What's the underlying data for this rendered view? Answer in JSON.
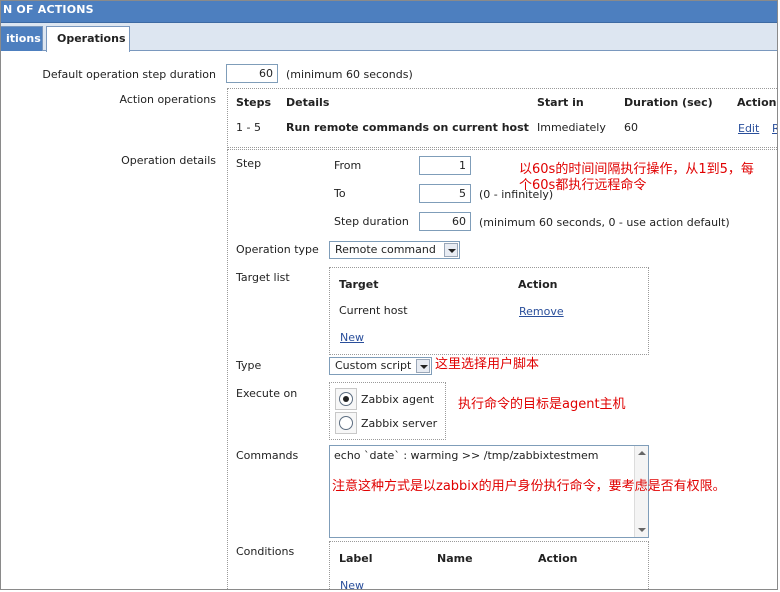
{
  "window": {
    "title": "N OF ACTIONS"
  },
  "tabs": [
    {
      "label": "itions",
      "active": false
    },
    {
      "label": "Operations",
      "active": true
    }
  ],
  "default_step": {
    "label": "Default operation step duration",
    "value": "60",
    "hint": "(minimum 60 seconds)"
  },
  "action_operations": {
    "label": "Action operations",
    "headers": {
      "steps": "Steps",
      "details": "Details",
      "start_in": "Start in",
      "duration": "Duration (sec)",
      "action": "Action"
    },
    "rows": [
      {
        "steps": "1 - 5",
        "details": "Run remote commands on current host",
        "start_in": "Immediately",
        "duration": "60",
        "edit": "Edit",
        "remove": "R"
      }
    ]
  },
  "operation_details": {
    "label": "Operation details",
    "step": {
      "label": "Step",
      "from_label": "From",
      "from_value": "1",
      "to_label": "To",
      "to_value": "5",
      "to_hint": "(0 - infinitely)",
      "duration_label": "Step duration",
      "duration_value": "60",
      "duration_hint": "(minimum 60 seconds, 0 - use action default)"
    },
    "operation_type": {
      "label": "Operation type",
      "value": "Remote command"
    },
    "target_list": {
      "label": "Target list",
      "col_target": "Target",
      "col_action": "Action",
      "row_target": "Current host",
      "row_action": "Remove",
      "new_link": "New"
    },
    "type": {
      "label": "Type",
      "value": "Custom script"
    },
    "execute_on": {
      "label": "Execute on",
      "options": [
        {
          "label": "Zabbix agent",
          "checked": true
        },
        {
          "label": "Zabbix server",
          "checked": false
        }
      ]
    },
    "commands": {
      "label": "Commands",
      "value": "echo `date` : warming >> /tmp/zabbixtestmem"
    },
    "conditions": {
      "label": "Conditions",
      "col_label": "Label",
      "col_name": "Name",
      "col_action": "Action",
      "new_link": "New"
    }
  },
  "annotations": {
    "step_note_line1": "以60s的时间间隔执行操作，从1到5，每",
    "step_note_line2": "个60s都执行远程命令",
    "type_note": "这里选择用户脚本",
    "execute_note": "执行命令的目标是agent主机",
    "command_note": "注意这种方式是以zabbix的用户身份执行命令，要考虑是否有权限。"
  },
  "colors": {
    "header_blue": "#4d7fbf",
    "link_blue": "#2a4f9b",
    "annotation_red": "#e00000"
  }
}
